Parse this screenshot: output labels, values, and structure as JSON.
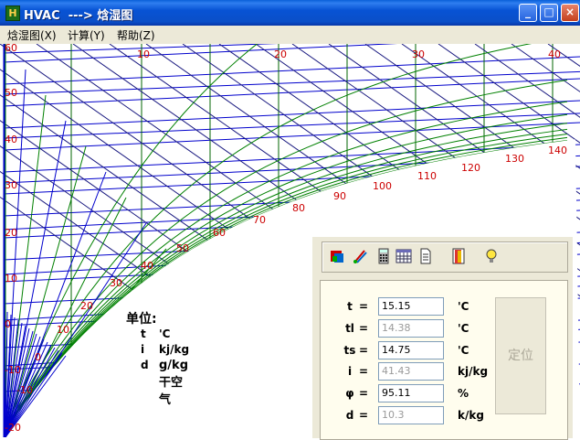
{
  "window": {
    "title": "HVAC  ---> 焓湿图"
  },
  "menu": [
    "焓湿图(X)",
    "计算(Y)",
    "帮助(Z)"
  ],
  "chart": {
    "temp_labels": [
      "60",
      "50",
      "40",
      "30",
      "20",
      "10",
      "0",
      "-10",
      "-20"
    ],
    "d_labels": [
      "10",
      "20",
      "30",
      "40"
    ],
    "i_labels": [
      "-10",
      "0",
      "10",
      "20",
      "30",
      "40",
      "50",
      "60",
      "70",
      "80",
      "90",
      "100",
      "110",
      "120",
      "130",
      "140"
    ],
    "colors": {
      "isotherm": "#0000cc",
      "enthalpy": "#1a1a80",
      "rh": "#008000",
      "label": "#cc0000"
    }
  },
  "units": {
    "title": "单位:",
    "rows": [
      {
        "sym": "t",
        "unit": "'C"
      },
      {
        "sym": "i",
        "unit": "kj/kg"
      },
      {
        "sym": "d",
        "unit": "g/kg干空气"
      }
    ]
  },
  "toolbar": [
    "colorize-icon",
    "brush-icon",
    "calculator-icon",
    "table-icon",
    "document-icon",
    "exit-door-icon",
    "bulb-icon"
  ],
  "fields": [
    {
      "label": "t",
      "value": "15.15",
      "unit": "'C",
      "readonly": false
    },
    {
      "label": "tl",
      "value": "14.38",
      "unit": "'C",
      "readonly": true
    },
    {
      "label": "ts",
      "value": "14.75",
      "unit": "'C",
      "readonly": false
    },
    {
      "label": "i",
      "value": "41.43",
      "unit": "kj/kg",
      "readonly": true
    },
    {
      "label": "φ",
      "value": "95.11",
      "unit": "%",
      "readonly": false
    },
    {
      "label": "d",
      "value": "10.3",
      "unit": "k/kg",
      "readonly": true
    }
  ],
  "eq": "=",
  "locate_button": "定位"
}
